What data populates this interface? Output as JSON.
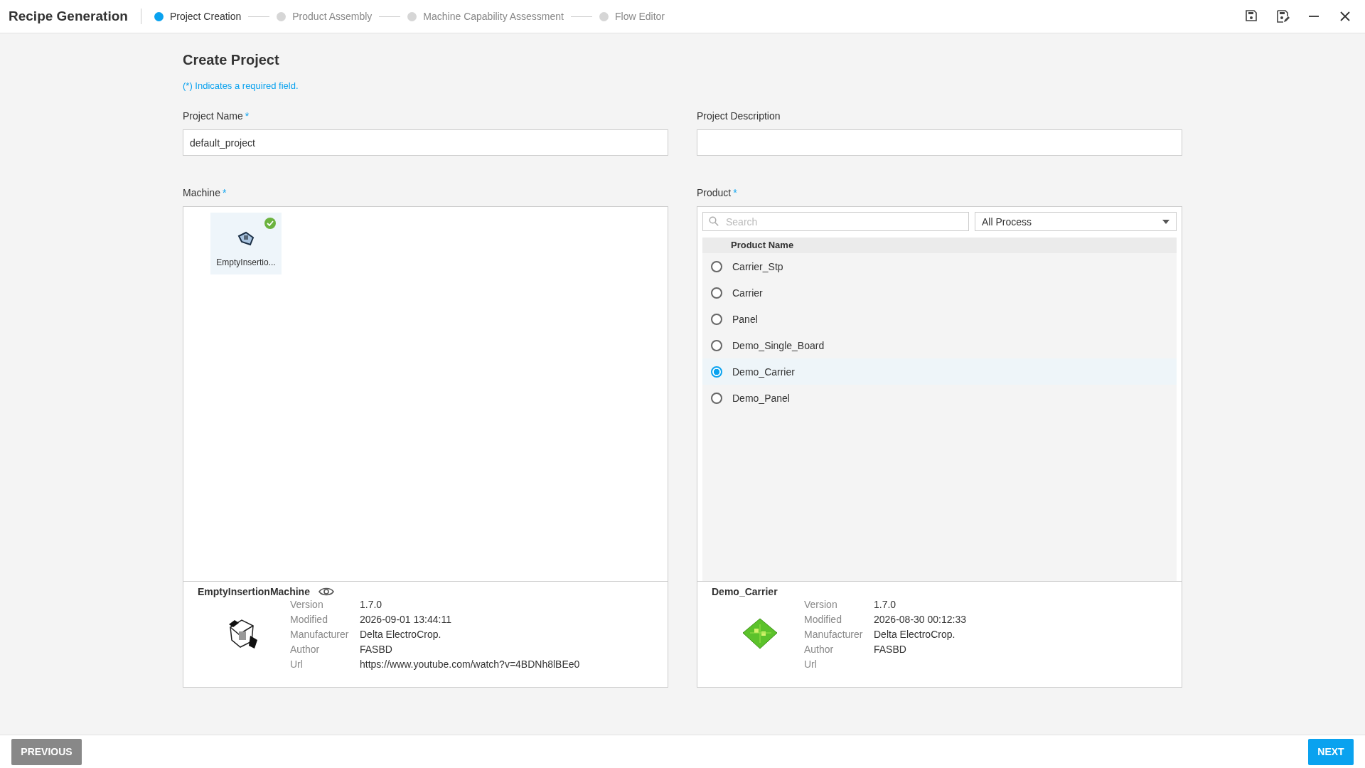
{
  "app": {
    "title": "Recipe Generation"
  },
  "steps": [
    {
      "label": "Project Creation",
      "selected": true
    },
    {
      "label": "Product Assembly",
      "selected": false
    },
    {
      "label": "Machine Capability Assessment",
      "selected": false
    },
    {
      "label": "Flow Editor",
      "selected": false
    }
  ],
  "window_controls": [
    {
      "kind": "save"
    },
    {
      "kind": "save_as"
    },
    {
      "kind": "minimize"
    },
    {
      "kind": "close"
    }
  ],
  "page": {
    "title": "Create Project",
    "note": "(*) Indicates a required field."
  },
  "fields": [
    {
      "label": "Project Name",
      "required_mark": "*",
      "value": "default_project"
    },
    {
      "label": "Project Description"
    }
  ],
  "machine": {
    "label": "Machine",
    "required_mark": "*",
    "tiles": [
      {
        "name": "EmptyInsertio...",
        "checked": true
      }
    ],
    "info": {
      "title": "EmptyInsertionMachine",
      "kind": "machine",
      "details": [
        {
          "label": "Version",
          "value": "1.7.0"
        },
        {
          "label": "Modified",
          "value": "2026-09-01 13:44:11"
        },
        {
          "label": "Manufacturer",
          "value": "Delta ElectroCrop."
        },
        {
          "label": "Author",
          "value": "FASBD"
        },
        {
          "label": "Url",
          "value": "https://www.youtube.com/watch?v=4BDNh8lBEe0"
        }
      ]
    }
  },
  "product": {
    "label": "Product",
    "required_mark": "*",
    "search": {
      "placeholder": "Search"
    },
    "filter": {
      "value": "All Process"
    },
    "column": "Product Name",
    "rows": [
      {
        "name": "Carrier_Stp",
        "selected": false
      },
      {
        "name": "Carrier",
        "selected": false
      },
      {
        "name": "Panel",
        "selected": false
      },
      {
        "name": "Demo_Single_Board",
        "selected": false
      },
      {
        "name": "Demo_Carrier",
        "selected": true
      },
      {
        "name": "Demo_Panel",
        "selected": false
      }
    ],
    "info": {
      "title": "Demo_Carrier",
      "kind": "board",
      "details": [
        {
          "label": "Version",
          "value": "1.7.0"
        },
        {
          "label": "Modified",
          "value": "2026-08-30 00:12:33"
        },
        {
          "label": "Manufacturer",
          "value": "Delta ElectroCrop."
        },
        {
          "label": "Author",
          "value": "FASBD"
        },
        {
          "label": "Url"
        }
      ]
    }
  },
  "footer": {
    "previous": "PREVIOUS",
    "next": "NEXT"
  }
}
